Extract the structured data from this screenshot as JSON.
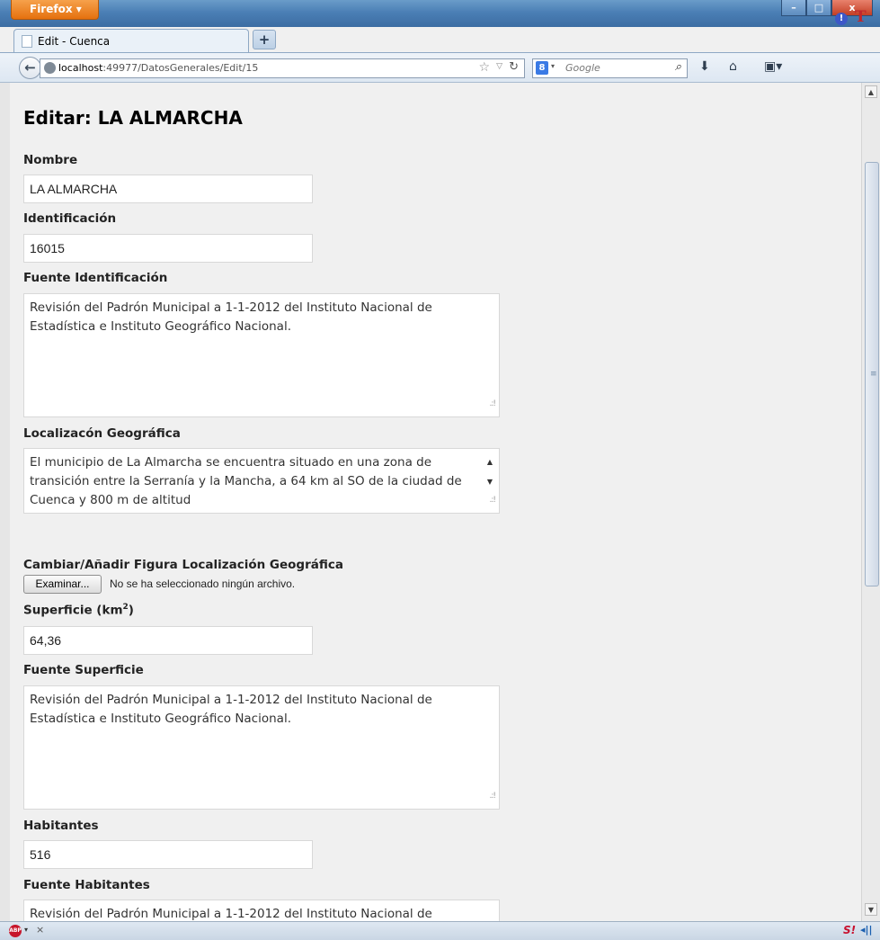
{
  "browser": {
    "app_button": "Firefox",
    "tab_title": "Edit - Cuenca",
    "new_tab": "+",
    "url_host": "localhost",
    "url_path": ":49977/DatosGenerales/Edit/15",
    "search_placeholder": "Google",
    "window_buttons": {
      "minimize": "–",
      "maximize": "□",
      "close": "x"
    }
  },
  "page": {
    "title": "Editar: LA ALMARCHA",
    "fields": {
      "nombre": {
        "label": "Nombre",
        "value": "LA ALMARCHA"
      },
      "identificacion": {
        "label": "Identificación",
        "value": "16015"
      },
      "fuente_identificacion": {
        "label": "Fuente Identificación",
        "value": "Revisión del Padrón Municipal a 1-1-2012 del Instituto Nacional de Estadística e Instituto Geográfico Nacional."
      },
      "localizacion": {
        "label": "Localizacón Geográfica",
        "value": "El municipio de La Almarcha se encuentra situado en una zona de transición entre la Serranía y la Mancha, a 64 km al SO de la ciudad de Cuenca y 800 m de altitud"
      },
      "figura": {
        "label": "Cambiar/Añadir Figura Localización Geográfica",
        "button": "Examinar...",
        "status": "No se ha seleccionado ningún archivo."
      },
      "superficie": {
        "label": "Superficie (km",
        "label_sup": "2",
        "label_end": ")",
        "value": "64,36"
      },
      "fuente_superficie": {
        "label": "Fuente Superficie",
        "value": "Revisión del Padrón Municipal a 1-1-2012 del Instituto Nacional de Estadística e Instituto Geográfico Nacional."
      },
      "habitantes": {
        "label": "Habitantes",
        "value": "516"
      },
      "fuente_habitantes": {
        "label": "Fuente Habitantes",
        "value": "Revisión del Padrón Municipal a 1-1-2012 del Instituto Nacional de"
      }
    }
  },
  "statusbar": {
    "abp": "ABP",
    "close": "×",
    "s_badge": "S!",
    "sound": "◂||"
  }
}
